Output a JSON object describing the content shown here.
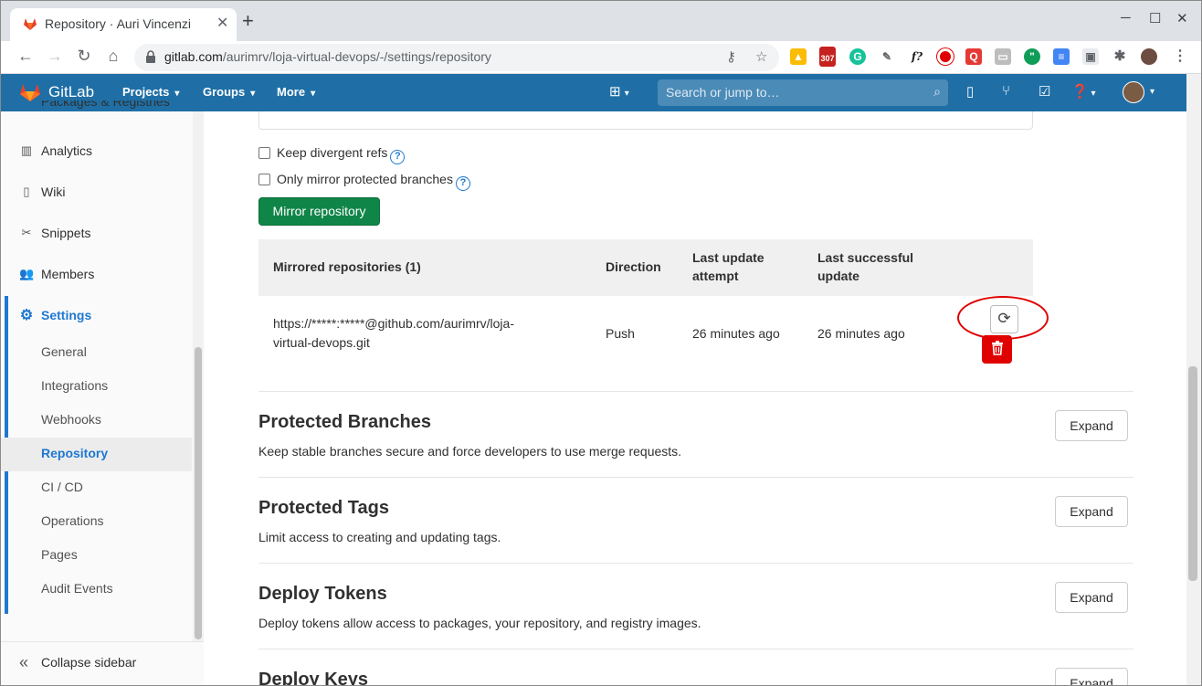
{
  "browser": {
    "tab_title": "Repository · Auri Vincenzi",
    "new_tab": "+",
    "close_tab": "✕",
    "url_host": "gitlab.com",
    "url_path": "/aurimrv/loja-virtual-devops/-/settings/repository",
    "extension_badge": "307",
    "extension_fq": "f?"
  },
  "gitlab_header": {
    "brand": "GitLab",
    "menus": [
      "Projects",
      "Groups",
      "More"
    ],
    "search_placeholder": "Search or jump to…"
  },
  "sidebar": {
    "partial_top": "Packages & Registries",
    "items": [
      {
        "label": "Analytics",
        "icon": "analytics-icon"
      },
      {
        "label": "Wiki",
        "icon": "book-icon"
      },
      {
        "label": "Snippets",
        "icon": "scissors-icon"
      },
      {
        "label": "Members",
        "icon": "users-icon"
      },
      {
        "label": "Settings",
        "icon": "gear-icon"
      }
    ],
    "settings_sub": [
      "General",
      "Integrations",
      "Webhooks",
      "Repository",
      "CI / CD",
      "Operations",
      "Pages",
      "Audit Events"
    ],
    "active_sub": "Repository",
    "collapse": "Collapse sidebar"
  },
  "mirror_options": {
    "keep_divergent": "Keep divergent refs",
    "only_protected": "Only mirror protected branches",
    "mirror_button": "Mirror repository"
  },
  "mirror_table": {
    "headers": {
      "repos": "Mirrored repositories (1)",
      "direction": "Direction",
      "last_attempt_1": "Last update",
      "last_attempt_2": "attempt",
      "last_success_1": "Last successful",
      "last_success_2": "update"
    },
    "row": {
      "url_1": "https://*****:*****@github.com/aurimrv/loja-",
      "url_2": "virtual-devops.git",
      "direction": "Push",
      "last_attempt": "26 minutes ago",
      "last_success": "26 minutes ago"
    }
  },
  "sections": [
    {
      "title": "Protected Branches",
      "desc": "Keep stable branches secure and force developers to use merge requests.",
      "button": "Expand"
    },
    {
      "title": "Protected Tags",
      "desc": "Limit access to creating and updating tags.",
      "button": "Expand"
    },
    {
      "title": "Deploy Tokens",
      "desc": "Deploy tokens allow access to packages, your repository, and registry images.",
      "button": "Expand"
    },
    {
      "title": "Deploy Keys",
      "desc": "",
      "button": "Expand"
    }
  ],
  "colors": {
    "header_bg": "#1f6fa6",
    "mirror_btn": "#108548",
    "delete_btn": "#e00000",
    "link_blue": "#1f78d1",
    "annotation_red": "#e00000"
  }
}
